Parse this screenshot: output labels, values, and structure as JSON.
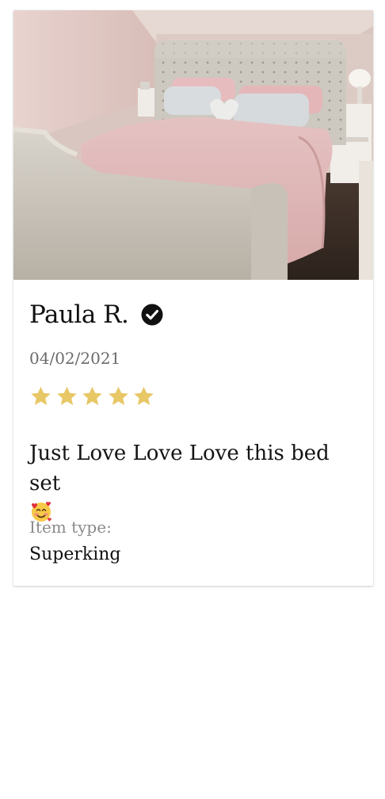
{
  "review": {
    "reviewer_name": "Paula R.",
    "verified_icon": "verified-check-icon",
    "date": "04/02/2021",
    "rating": 5,
    "rating_max": 5,
    "star_color": "#E8C766",
    "text": "Just Love Love Love this bed set",
    "text_emoji": "smiling-face-with-hearts-emoji",
    "item_type_label": "Item type:",
    "item_type_value": "Superking",
    "photo": "bedroom-bed-photo"
  }
}
